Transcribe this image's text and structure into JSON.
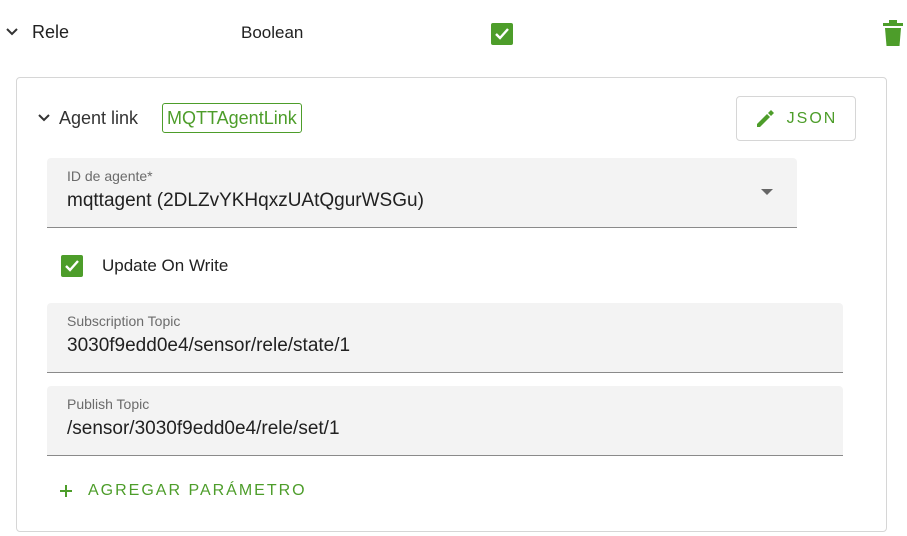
{
  "attribute": {
    "name": "Rele",
    "type": "Boolean",
    "checked": true
  },
  "agent_link": {
    "label": "Agent link",
    "chip": "MQTTAgentLink",
    "json_button": "JSON",
    "agent_field": {
      "label": "ID de agente*",
      "value": "mqttagent (2DLZvYKHqxzUAtQgurWSGu)"
    },
    "update_on_write": {
      "label": "Update On Write",
      "checked": true
    },
    "subscription_topic": {
      "label": "Subscription Topic",
      "value": "3030f9edd0e4/sensor/rele/state/1"
    },
    "publish_topic": {
      "label": "Publish Topic",
      "value": "/sensor/3030f9edd0e4/rele/set/1"
    },
    "add_parameter": "AGREGAR PARÁMETRO"
  },
  "colors": {
    "accent": "#4d9d2a",
    "field_bg": "#f3f3f3",
    "border": "#d6d6d6"
  },
  "icons": [
    "chevron-down-icon",
    "checkbox-checked-icon",
    "trash-icon",
    "pencil-icon",
    "dropdown-arrow-icon",
    "plus-icon"
  ]
}
